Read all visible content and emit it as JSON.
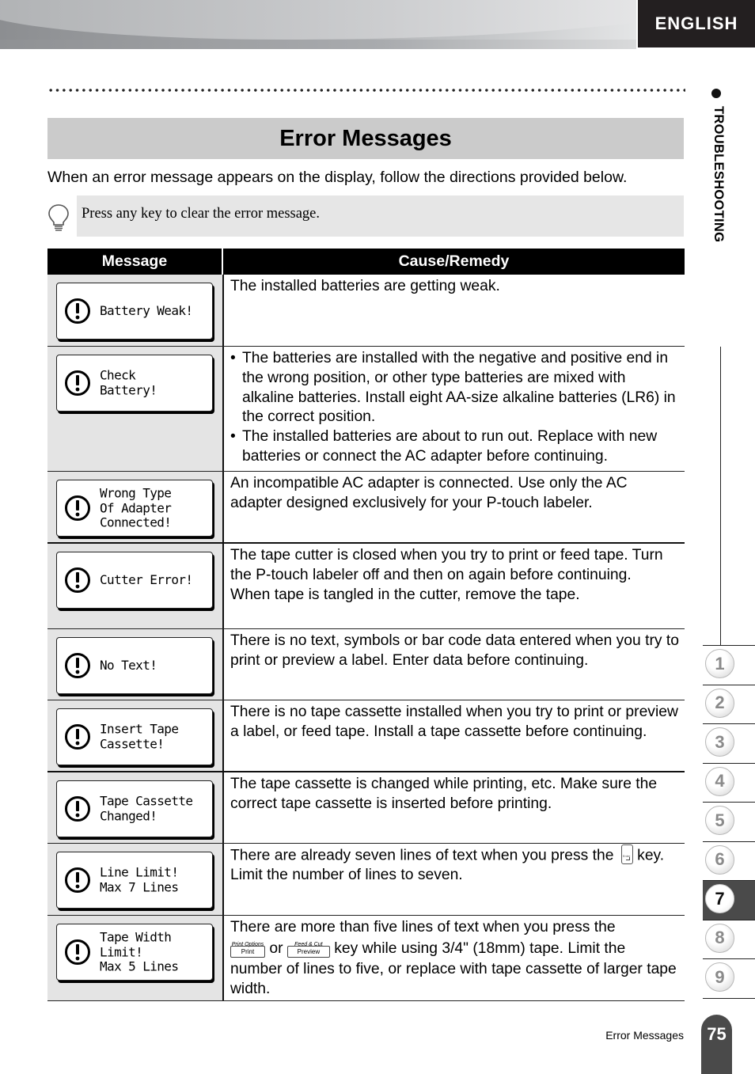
{
  "header": {
    "language_tab": "ENGLISH"
  },
  "side": {
    "section_label": "TROUBLESHOOTING",
    "chapters": [
      "1",
      "2",
      "3",
      "4",
      "5",
      "6",
      "7",
      "8",
      "9"
    ],
    "active_chapter": "7"
  },
  "page": {
    "title": "Error Messages",
    "intro": "When an error message appears on the display, follow the directions provided below.",
    "note": "Press any key to clear the error message.",
    "note_icon": "lightbulb-icon"
  },
  "table": {
    "headers": {
      "message": "Message",
      "cause": "Cause/Remedy"
    },
    "rows": [
      {
        "lcd": "Battery Weak!",
        "icon": "warning-icon",
        "cause": "The installed batteries are getting weak."
      },
      {
        "lcd": "Check\nBattery!",
        "icon": "warning-icon",
        "bullets": [
          "The batteries are installed with the negative and positive end in the wrong position, or other type batteries are mixed with alkaline batteries. Install eight AA-size alkaline batteries (LR6) in the correct position.",
          "The installed batteries are about to run out. Replace with new batteries or connect the AC adapter before continuing."
        ]
      },
      {
        "lcd": "Wrong Type\nOf Adapter\nConnected!",
        "icon": "warning-icon",
        "cause": "An incompatible AC adapter is connected. Use only the AC adapter designed exclusively for your P-touch labeler."
      },
      {
        "lcd": "Cutter Error!",
        "icon": "warning-icon",
        "cause": "The tape cutter is closed when you try to print or feed tape. Turn the P-touch labeler off and then on again before continuing.",
        "cause2": "When tape is tangled in the cutter, remove the tape."
      },
      {
        "lcd": "No Text!",
        "icon": "warning-icon",
        "cause": "There is no text, symbols or bar code data entered when you try to print or preview a label. Enter data before continuing."
      },
      {
        "lcd": "Insert Tape\nCassette!",
        "icon": "warning-icon",
        "cause": "There is no tape cassette installed when you try to print or preview a label, or feed tape. Install a tape cassette before continuing."
      },
      {
        "lcd": "Tape Cassette\nChanged!",
        "icon": "warning-icon",
        "cause": "The tape cassette is changed while printing, etc. Make sure the correct tape cassette is inserted before printing."
      },
      {
        "lcd": "Line Limit!\nMax 7 Lines",
        "icon": "warning-icon",
        "cause_before": "There are already seven lines of text when you press the",
        "key": "Enter",
        "cause_after": "key. Limit the number of lines to seven."
      },
      {
        "lcd": "Tape Width\nLimit!\nMax 5 Lines",
        "icon": "warning-icon",
        "cause_before": "There are more than five lines of text when you press the",
        "key1": {
          "top": "Print Options",
          "label": "Print"
        },
        "or": "or",
        "key2": {
          "top": "Feed & Cut",
          "label": "Preview"
        },
        "cause_after": "key while using 3/4\" (18mm) tape. Limit the number of lines to five, or replace with tape cassette of larger tape width."
      }
    ]
  },
  "footer": {
    "section": "Error Messages",
    "page_number": "75"
  }
}
